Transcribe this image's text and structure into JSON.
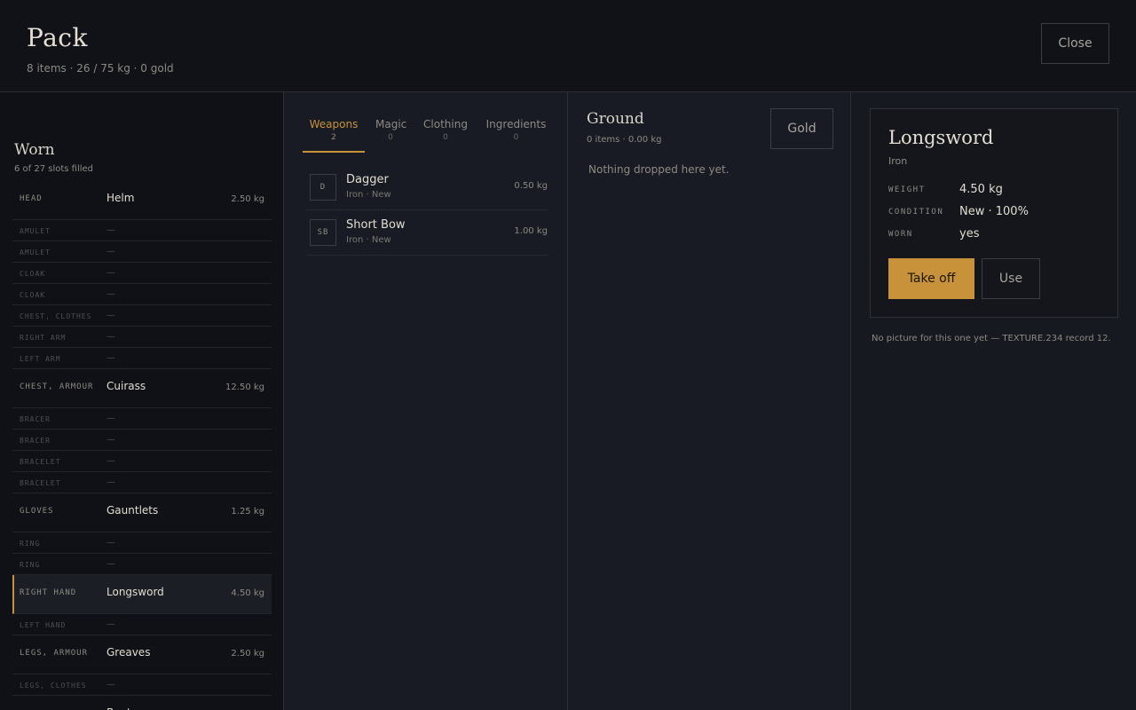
{
  "header": {
    "title": "Pack",
    "subtitle": "8 items · 26 / 75 kg · 0 gold",
    "close_label": "Close"
  },
  "worn": {
    "title": "Worn",
    "subtitle": "6 of 27 slots filled",
    "empty_marker": "—",
    "slots": [
      {
        "label": "HEAD",
        "item": "Helm",
        "weight": "2.50 kg",
        "filled": true
      },
      {
        "label": "AMULET",
        "item": "—",
        "weight": "",
        "filled": false
      },
      {
        "label": "AMULET",
        "item": "—",
        "weight": "",
        "filled": false
      },
      {
        "label": "CLOAK",
        "item": "—",
        "weight": "",
        "filled": false
      },
      {
        "label": "CLOAK",
        "item": "—",
        "weight": "",
        "filled": false
      },
      {
        "label": "CHEST, CLOTHES",
        "item": "—",
        "weight": "",
        "filled": false
      },
      {
        "label": "RIGHT ARM",
        "item": "—",
        "weight": "",
        "filled": false
      },
      {
        "label": "LEFT ARM",
        "item": "—",
        "weight": "",
        "filled": false
      },
      {
        "label": "CHEST, ARMOUR",
        "item": "Cuirass",
        "weight": "12.50 kg",
        "filled": true
      },
      {
        "label": "BRACER",
        "item": "—",
        "weight": "",
        "filled": false
      },
      {
        "label": "BRACER",
        "item": "—",
        "weight": "",
        "filled": false
      },
      {
        "label": "BRACELET",
        "item": "—",
        "weight": "",
        "filled": false
      },
      {
        "label": "BRACELET",
        "item": "—",
        "weight": "",
        "filled": false
      },
      {
        "label": "GLOVES",
        "item": "Gauntlets",
        "weight": "1.25 kg",
        "filled": true
      },
      {
        "label": "RING",
        "item": "—",
        "weight": "",
        "filled": false
      },
      {
        "label": "RING",
        "item": "—",
        "weight": "",
        "filled": false
      },
      {
        "label": "RIGHT HAND",
        "item": "Longsword",
        "weight": "4.50 kg",
        "filled": true,
        "selected": true
      },
      {
        "label": "LEFT HAND",
        "item": "—",
        "weight": "",
        "filled": false
      },
      {
        "label": "LEGS, ARMOUR",
        "item": "Greaves",
        "weight": "2.50 kg",
        "filled": true
      },
      {
        "label": "LEGS, CLOTHES",
        "item": "—",
        "weight": "",
        "filled": false
      },
      {
        "label": "",
        "item": "Boots",
        "weight": "",
        "filled": true
      }
    ]
  },
  "inventory": {
    "tabs": [
      {
        "label": "Weapons",
        "count": "2",
        "active": true
      },
      {
        "label": "Magic",
        "count": "0",
        "active": false
      },
      {
        "label": "Clothing",
        "count": "0",
        "active": false
      },
      {
        "label": "Ingredients",
        "count": "0",
        "active": false
      }
    ],
    "items": [
      {
        "badge": "D",
        "name": "Dagger",
        "sub": "Iron · New",
        "weight": "0.50 kg"
      },
      {
        "badge": "SB",
        "name": "Short Bow",
        "sub": "Iron · New",
        "weight": "1.00 kg"
      }
    ]
  },
  "ground": {
    "title": "Ground",
    "subtitle": "0 items · 0.00 kg",
    "gold_label": "Gold",
    "empty_text": "Nothing dropped here yet."
  },
  "detail": {
    "title": "Longsword",
    "subtitle": "Iron",
    "props": [
      {
        "key": "WEIGHT",
        "value": "4.50 kg"
      },
      {
        "key": "CONDITION",
        "value": "New · 100%"
      },
      {
        "key": "WORN",
        "value": "yes"
      }
    ],
    "primary_action": "Take off",
    "secondary_action": "Use",
    "note": "No picture for this one yet — TEXTURE.234 record 12."
  },
  "colors": {
    "accent": "#c8923a",
    "background": "#16181f",
    "header_bg": "#101217"
  }
}
